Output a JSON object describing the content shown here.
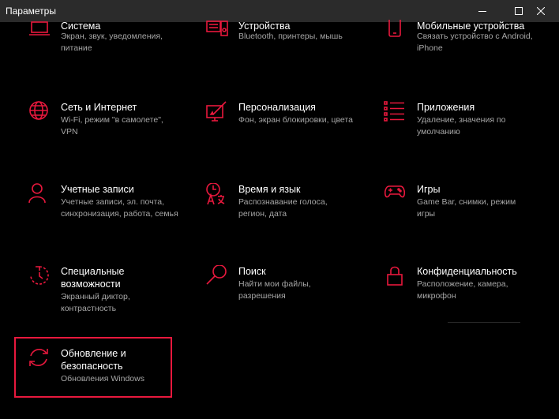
{
  "window": {
    "title": "Параметры"
  },
  "accent": "#e8183d",
  "tiles": [
    {
      "name": "Система",
      "desc": "Экран, звук, уведомления, питание",
      "icon": "laptop-icon"
    },
    {
      "name": "Устройства",
      "desc": "Bluetooth, принтеры, мышь",
      "icon": "devices-icon"
    },
    {
      "name": "Мобильные устройства",
      "desc": "Связать устройство с Android, iPhone",
      "icon": "phone-icon"
    },
    {
      "name": "Сеть и Интернет",
      "desc": "Wi-Fi, режим \"в самолете\", VPN",
      "icon": "globe-icon"
    },
    {
      "name": "Персонализация",
      "desc": "Фон, экран блокировки, цвета",
      "icon": "personalization-icon"
    },
    {
      "name": "Приложения",
      "desc": "Удаление, значения по умолчанию",
      "icon": "apps-list-icon"
    },
    {
      "name": "Учетные записи",
      "desc": "Учетные записи, эл. почта, синхронизация, работа, семья",
      "icon": "person-icon"
    },
    {
      "name": "Время и язык",
      "desc": "Распознавание голоса, регион, дата",
      "icon": "time-language-icon"
    },
    {
      "name": "Игры",
      "desc": "Game Bar, снимки, режим игры",
      "icon": "gamepad-icon"
    },
    {
      "name": "Специальные возможности",
      "desc": "Экранный диктор, контрастность",
      "icon": "accessibility-icon"
    },
    {
      "name": "Поиск",
      "desc": "Найти мои файлы, разрешения",
      "icon": "search-icon"
    },
    {
      "name": "Конфиденциальность",
      "desc": "Расположение, камера, микрофон",
      "icon": "lock-icon"
    },
    {
      "name": "Обновление и безопасность",
      "desc": "Обновления Windows",
      "icon": "refresh-icon"
    }
  ]
}
